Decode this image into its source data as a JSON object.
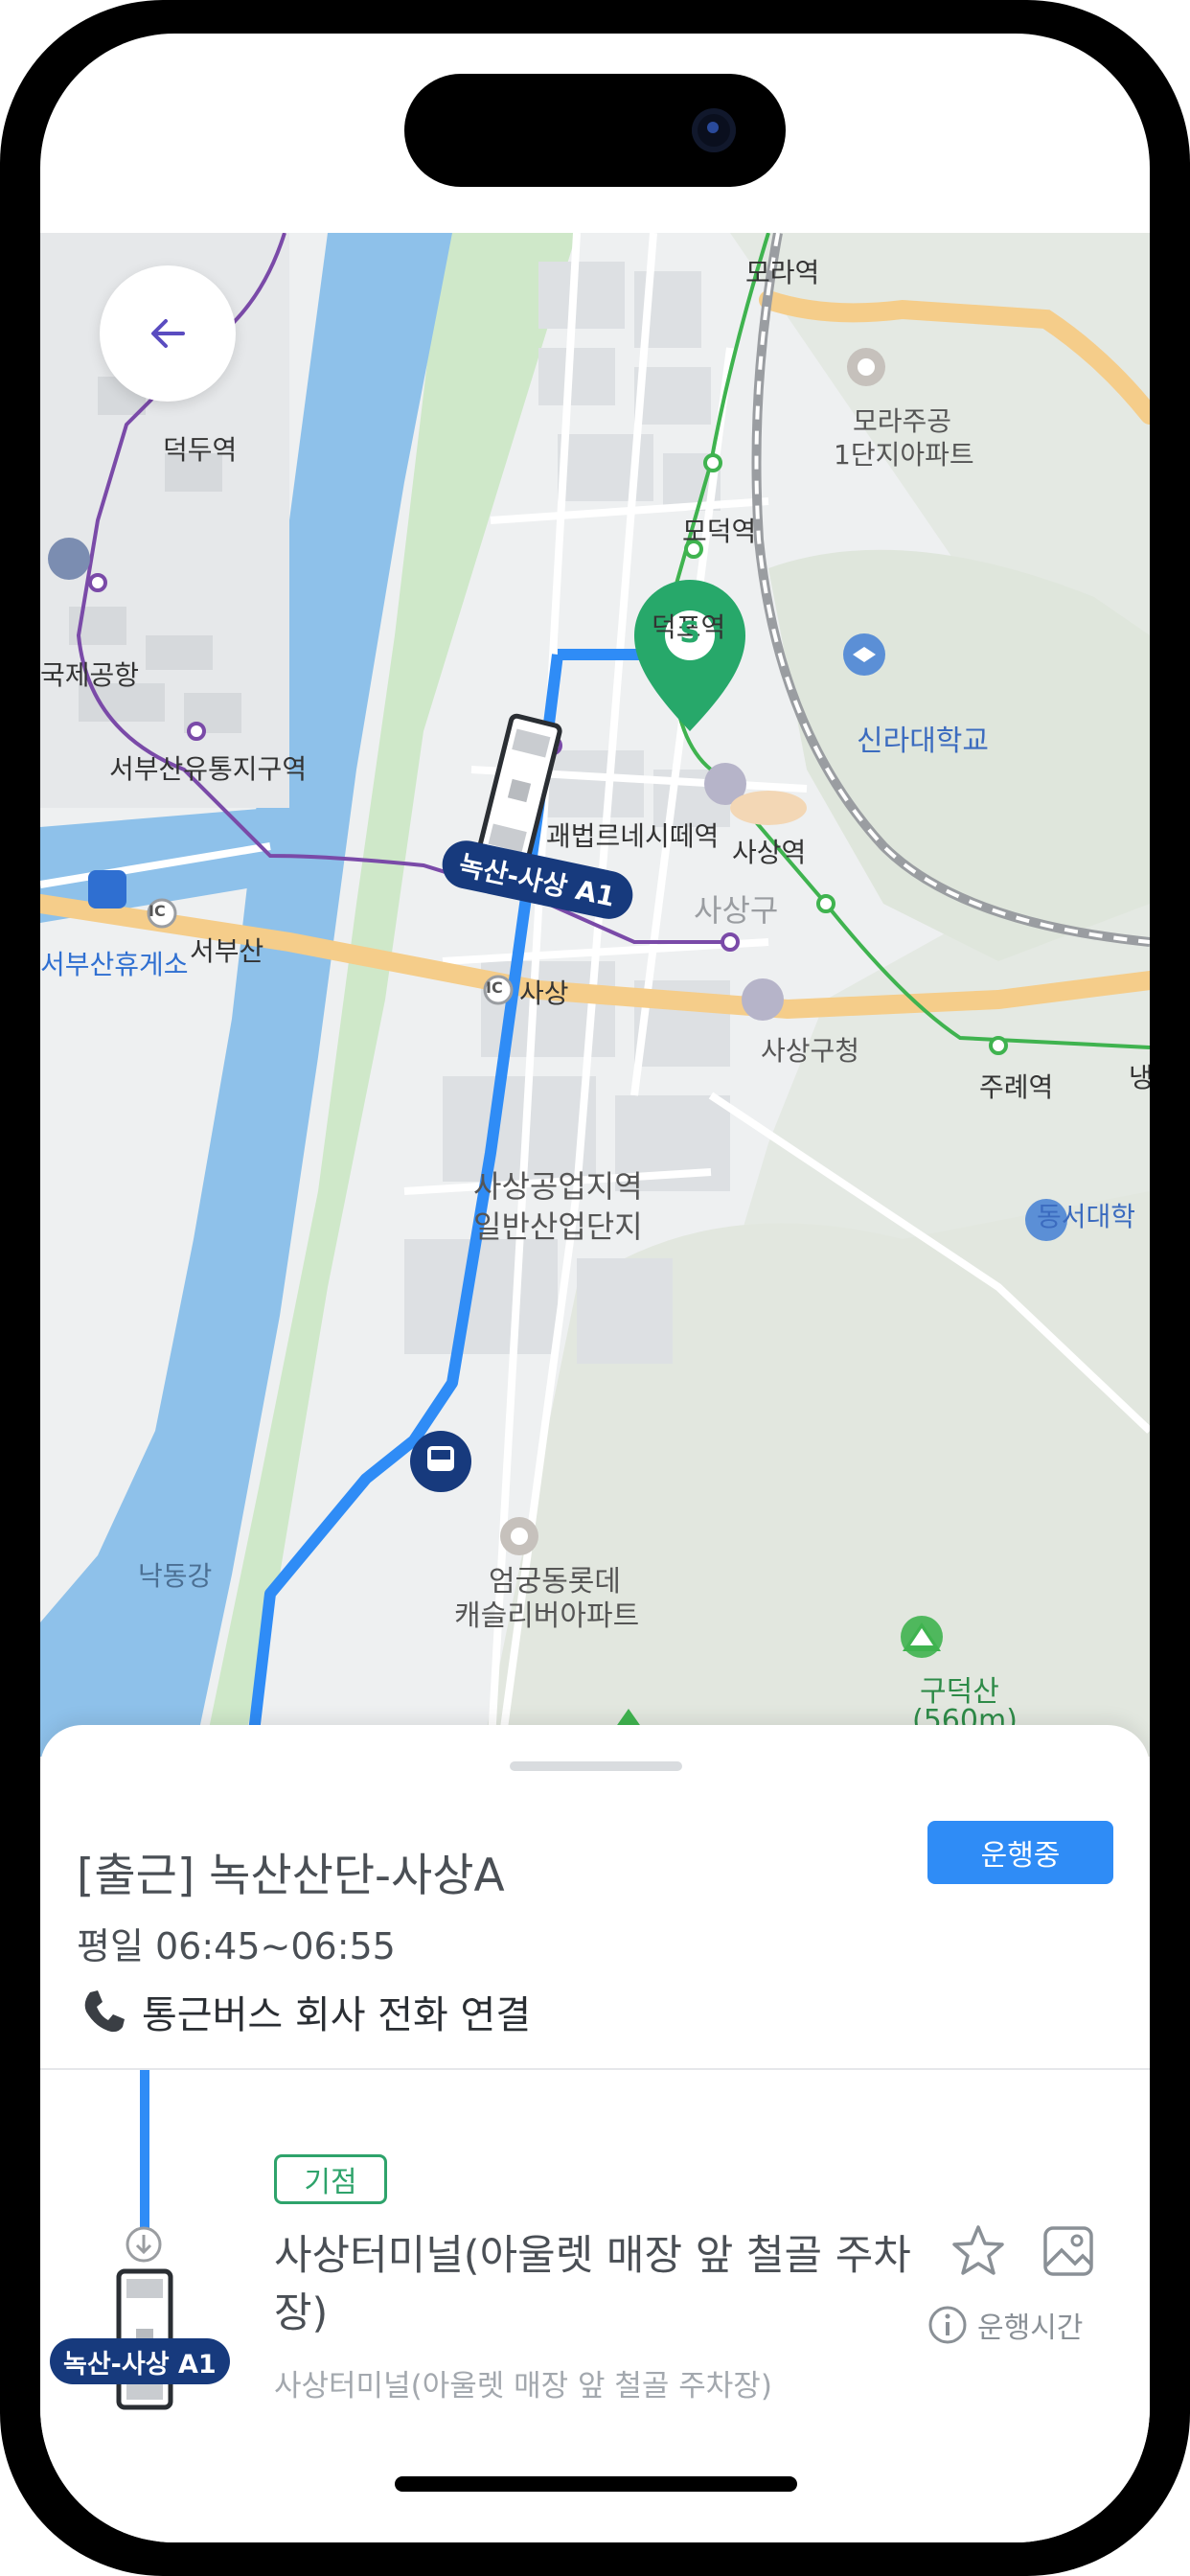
{
  "map": {
    "labels": {
      "mora": "모라역",
      "morajugong": "모라주공",
      "morajugong2": "1단지아파트",
      "deokdu": "덕두역",
      "modeok": "모덕역",
      "airport": "국제공항",
      "deokpo": "덕포역",
      "silla": "신라대학교",
      "seobusan_yutong": "서부산유통지구역",
      "gwaebeop": "괘법르네시떼역",
      "sasang_st": "사상역",
      "sasang_gu": "사상구",
      "seobusan_ic": "서부산",
      "seobusan_rest": "서부산휴게소",
      "sasang_ic": "사상",
      "sasang_office": "사상구청",
      "jurye": "주례역",
      "nang": "냉",
      "industrial1": "사상공업지역",
      "industrial2": "일반산업단지",
      "dongseo": "동서대학",
      "nakdong": "낙동강",
      "eomgung1": "엄궁동롯데",
      "eomgung2": "캐슬리버아파트",
      "gudeok1": "구덕산",
      "gudeok2": "(560m)",
      "ic": "IC",
      "start_pin": "S"
    },
    "bus_label": "녹산-사상 A1"
  },
  "header": {
    "back_icon": "arrow-left-icon"
  },
  "sheet": {
    "title": "[출근] 녹산산단-사상A",
    "status": "운행중",
    "schedule": "평일 06:45~06:55",
    "call_label": "통근버스 회사 전화 연결",
    "stop": {
      "tag": "기점",
      "name": "사상터미널(아울렛 매장 앞 철골 주차장)",
      "sub": "사상터미널(아울렛 매장 앞 철골 주차장)",
      "bus_label": "녹산-사상 A1",
      "hours_label": "운행시간"
    }
  },
  "colors": {
    "accent": "#2f8cf6",
    "bus_label_bg": "#173a7d",
    "origin_green": "#2ea36b",
    "river": "#7fb5e4",
    "route": "#2f8cf6"
  }
}
